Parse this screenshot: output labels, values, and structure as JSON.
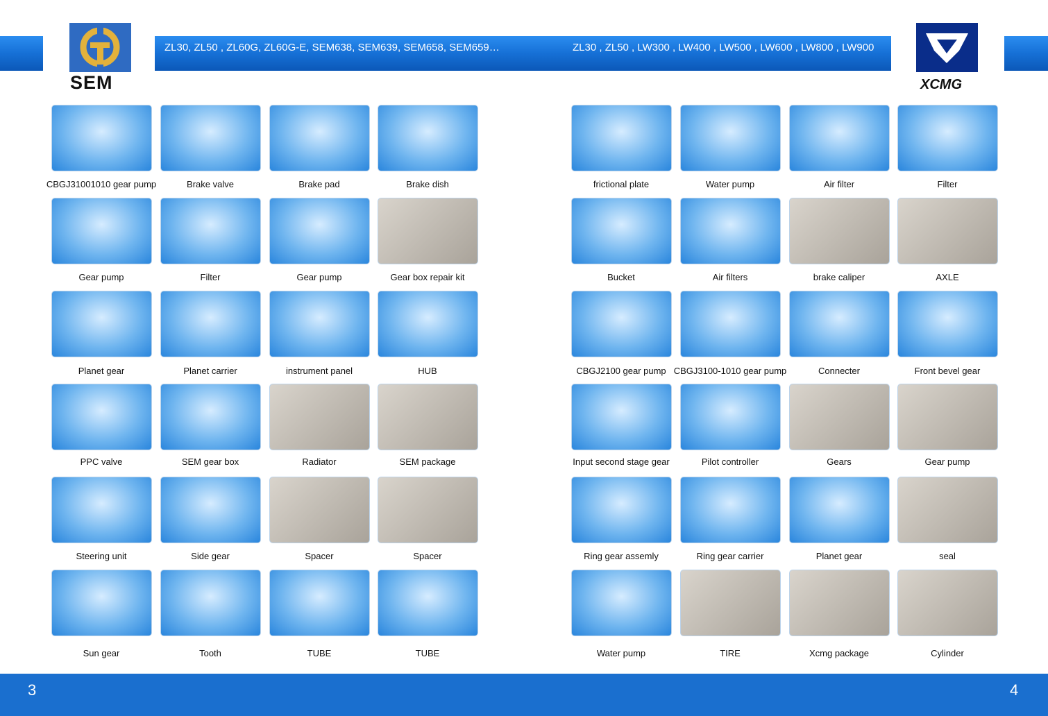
{
  "header": {
    "left_models": "ZL30, ZL50 , ZL60G, ZL60G-E, SEM638, SEM639, SEM658, SEM659…",
    "right_models": "ZL30 , ZL50 , LW300 , LW400 , LW500 , LW600 , LW800 , LW900"
  },
  "logos": {
    "left": "SEM",
    "right": "XCMG"
  },
  "colors": {
    "band": "#1670d6",
    "footer": "#1a6fcf",
    "sem_logo": "#2f6bc2",
    "sem_mark": "#e3b23c",
    "xcmg_logo": "#0a2d8a"
  },
  "left_products": [
    [
      "CBGJ31001010 gear pump",
      "Brake valve",
      "Brake pad",
      "Brake dish"
    ],
    [
      "Gear pump",
      "Filter",
      "Gear pump",
      "Gear box repair kit"
    ],
    [
      "Planet gear",
      "Planet carrier",
      "instrument panel",
      "HUB"
    ],
    [
      "PPC valve",
      "SEM gear box",
      "Radiator",
      "SEM package"
    ],
    [
      "Steering unit",
      "Side gear",
      "Spacer",
      "Spacer"
    ],
    [
      "Sun gear",
      "Tooth",
      "TUBE",
      "TUBE"
    ]
  ],
  "right_products": [
    [
      "frictional plate",
      "Water pump",
      "Air filter",
      "Filter"
    ],
    [
      "Bucket",
      "Air filters",
      "brake caliper",
      "AXLE"
    ],
    [
      "CBGJ2100  gear pump",
      "CBGJ3100-1010  gear pump",
      "Connecter",
      "Front bevel gear"
    ],
    [
      "Input second stage gear",
      "Pilot controller",
      "Gears",
      "Gear pump"
    ],
    [
      "Ring gear assemly",
      "Ring gear carrier",
      "Planet gear",
      "seal"
    ],
    [
      "Water pump",
      "TIRE",
      "Xcmg package",
      "Cylinder"
    ]
  ],
  "footer": {
    "page_left": "3",
    "page_right": "4"
  }
}
